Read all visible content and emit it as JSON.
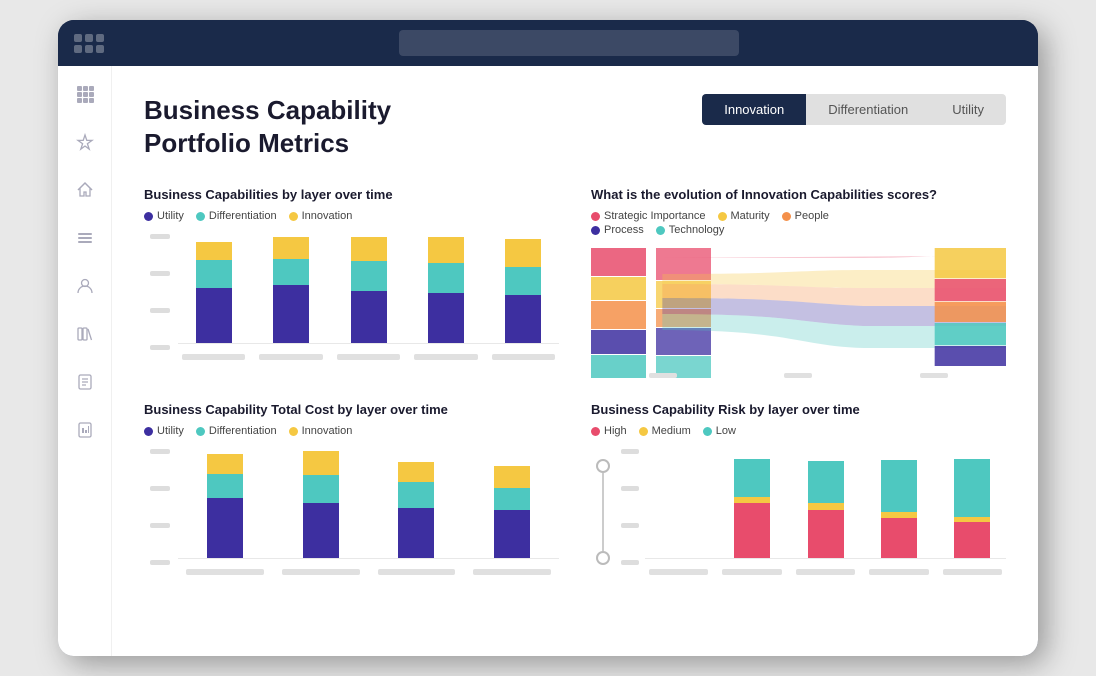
{
  "browser": {
    "addressbar_placeholder": ""
  },
  "page": {
    "title_line1": "Business Capability",
    "title_line2": "Portfolio Metrics"
  },
  "tabs": [
    {
      "label": "Innovation",
      "active": true
    },
    {
      "label": "Differentiation",
      "active": false
    },
    {
      "label": "Utility",
      "active": false
    }
  ],
  "sidebar": {
    "icons": [
      "⋮⋮⋮",
      "☆",
      "⌂",
      "☰",
      "👤",
      "📚",
      "📄",
      "📋"
    ]
  },
  "chart1": {
    "title": "Business Capabilities by layer over time",
    "legend": [
      {
        "label": "Utility",
        "color": "#3d2fa0"
      },
      {
        "label": "Differentiation",
        "color": "#4ec8c0"
      },
      {
        "label": "Innovation",
        "color": "#f5c842"
      }
    ],
    "bars": [
      {
        "utility": 55,
        "diff": 28,
        "innov": 18
      },
      {
        "utility": 58,
        "diff": 26,
        "innov": 22
      },
      {
        "utility": 52,
        "diff": 30,
        "innov": 24
      },
      {
        "utility": 50,
        "diff": 30,
        "innov": 26
      },
      {
        "utility": 48,
        "diff": 28,
        "innov": 28
      }
    ]
  },
  "chart2": {
    "title": "What is the evolution of Innovation Capabilities scores?",
    "legend": [
      {
        "label": "Strategic Importance",
        "color": "#e84c6c"
      },
      {
        "label": "Maturity",
        "color": "#f5c842"
      },
      {
        "label": "People",
        "color": "#f4904a"
      },
      {
        "label": "Process",
        "color": "#3d2fa0"
      },
      {
        "label": "Technology",
        "color": "#4ec8c0"
      }
    ]
  },
  "chart3": {
    "title": "Business Capability Total Cost by layer over time",
    "legend": [
      {
        "label": "Utility",
        "color": "#3d2fa0"
      },
      {
        "label": "Differentiation",
        "color": "#4ec8c0"
      },
      {
        "label": "Innovation",
        "color": "#f5c842"
      }
    ],
    "bars": [
      {
        "utility": 60,
        "diff": 24,
        "innov": 20
      },
      {
        "utility": 55,
        "diff": 28,
        "innov": 24
      },
      {
        "utility": 50,
        "diff": 26,
        "innov": 20
      },
      {
        "utility": 48,
        "diff": 22,
        "innov": 22
      }
    ]
  },
  "chart4": {
    "title": "Business Capability Risk by layer over time",
    "legend": [
      {
        "label": "High",
        "color": "#e84c6c"
      },
      {
        "label": "Medium",
        "color": "#f5c842"
      },
      {
        "label": "Low",
        "color": "#4ec8c0"
      }
    ],
    "bars": [
      {
        "high": 0,
        "medium": 0,
        "low": 0,
        "empty": true
      },
      {
        "high": 55,
        "medium": 6,
        "low": 38
      },
      {
        "high": 48,
        "medium": 8,
        "low": 40
      },
      {
        "high": 40,
        "medium": 6,
        "low": 52
      },
      {
        "high": 36,
        "medium": 5,
        "low": 58
      }
    ]
  }
}
